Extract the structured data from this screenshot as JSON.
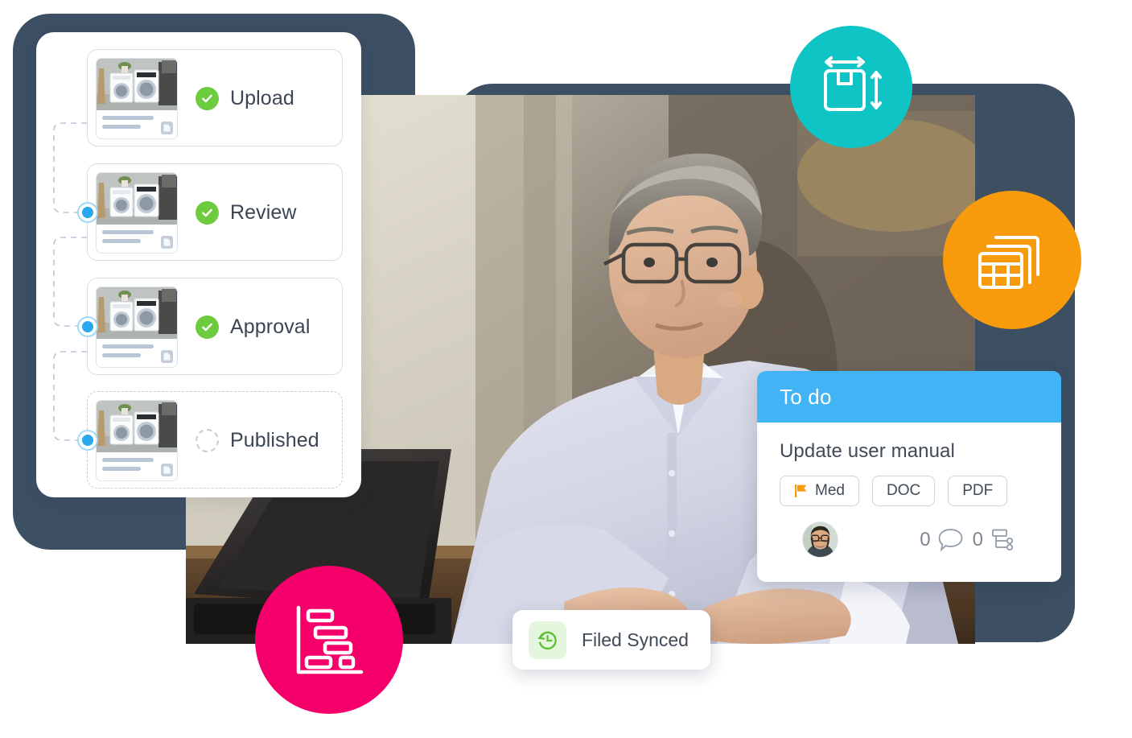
{
  "workflow": {
    "card_name": "document-workflow-card",
    "steps": [
      {
        "label": "Upload",
        "status": "complete",
        "status_icon": "check-circle-icon",
        "thumbnail": "washing-machines-product-photo"
      },
      {
        "label": "Review",
        "status": "complete",
        "status_icon": "check-circle-icon",
        "thumbnail": "washing-machines-product-photo"
      },
      {
        "label": "Approval",
        "status": "complete",
        "status_icon": "check-circle-icon",
        "thumbnail": "washing-machines-product-photo"
      },
      {
        "label": "Published",
        "status": "pending",
        "status_icon": "empty-dashed-circle-icon",
        "thumbnail": "washing-machines-product-photo"
      }
    ],
    "node_dot_count": 3
  },
  "todo": {
    "header_title": "To do",
    "task_title": "Update user manual",
    "tags": [
      {
        "label": "Med",
        "icon": "flag-icon"
      },
      {
        "label": "DOC",
        "icon": null
      },
      {
        "label": "PDF",
        "icon": null
      }
    ],
    "assignee_avatar": "user-avatar",
    "comment_count": "0",
    "subtask_count": "0",
    "comment_icon": "speech-bubble-icon",
    "subtask_icon": "hierarchy-icon"
  },
  "filed_sync": {
    "label": "Filed Synced",
    "icon": "history-clock-icon"
  },
  "badges": [
    {
      "name": "badge-dimensions",
      "icon": "box-dimensions-icon",
      "color": "#0fc4c4"
    },
    {
      "name": "badge-tables",
      "icon": "stacked-tables-icon",
      "color": "#f79b0c"
    },
    {
      "name": "badge-gantt",
      "icon": "gantt-chart-icon",
      "color": "#f5006b"
    }
  ],
  "photo": {
    "name": "man-working-on-laptop-photo",
    "alt": "Man with glasses typing on a laptop in an office"
  },
  "colors": {
    "navy_frame": "#3d4f63",
    "todo_header_blue": "#42b3f4",
    "node_blue": "#29a8ef",
    "check_green": "#6dcb3e",
    "teal": "#0fc4c4",
    "orange": "#f79b0c",
    "pink": "#f5006b",
    "flag_orange": "#f79b0c",
    "sync_green": "#5cbf2f"
  }
}
